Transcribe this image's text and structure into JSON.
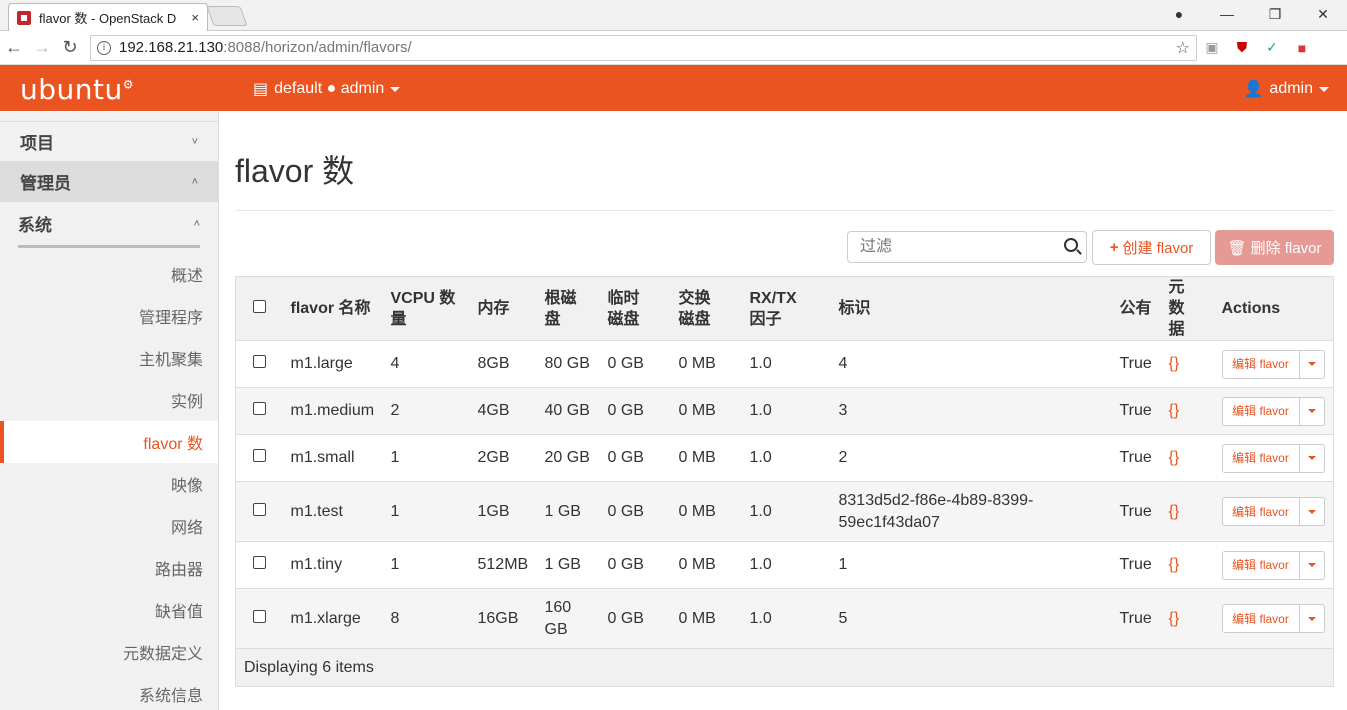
{
  "browser": {
    "tab_title": "flavor 数 - OpenStack D",
    "tab_close": "×",
    "url_host": "192.168.21.130",
    "url_path": ":8088/horizon/admin/flavors/",
    "win_min": "—",
    "win_max": "❐",
    "win_close": "✕"
  },
  "header": {
    "logo": "ubuntu",
    "project": "default ● admin",
    "user": "admin"
  },
  "sidebar": {
    "sections": [
      {
        "label": "项目",
        "chev": "˅"
      },
      {
        "label": "管理员",
        "chev": "˄"
      },
      {
        "label": "系统",
        "chev": "˄"
      }
    ],
    "items": [
      {
        "label": "概述"
      },
      {
        "label": "管理程序"
      },
      {
        "label": "主机聚集"
      },
      {
        "label": "实例"
      },
      {
        "label": "flavor 数"
      },
      {
        "label": "映像"
      },
      {
        "label": "网络"
      },
      {
        "label": "路由器"
      },
      {
        "label": "缺省值"
      },
      {
        "label": "元数据定义"
      },
      {
        "label": "系统信息"
      }
    ]
  },
  "main": {
    "title": "flavor 数",
    "filter_placeholder": "过滤",
    "create_label": "创建 flavor",
    "delete_label": "删除 flavor"
  },
  "table": {
    "headers": [
      "flavor 名称",
      "VCPU 数量",
      "内存",
      "根磁盘",
      "临时磁盘",
      "交换磁盘",
      "RX/TX 因子",
      "标识",
      "公有",
      "元数据",
      "Actions"
    ],
    "edit_label": "编辑 flavor",
    "rows": [
      {
        "name": "m1.large",
        "vcpu": "4",
        "ram": "8GB",
        "root": "80 GB",
        "eph": "0 GB",
        "swap": "0 MB",
        "rxtx": "1.0",
        "id": "4",
        "public": "True",
        "meta": "{}"
      },
      {
        "name": "m1.medium",
        "vcpu": "2",
        "ram": "4GB",
        "root": "40 GB",
        "eph": "0 GB",
        "swap": "0 MB",
        "rxtx": "1.0",
        "id": "3",
        "public": "True",
        "meta": "{}"
      },
      {
        "name": "m1.small",
        "vcpu": "1",
        "ram": "2GB",
        "root": "20 GB",
        "eph": "0 GB",
        "swap": "0 MB",
        "rxtx": "1.0",
        "id": "2",
        "public": "True",
        "meta": "{}"
      },
      {
        "name": "m1.test",
        "vcpu": "1",
        "ram": "1GB",
        "root": "1 GB",
        "eph": "0 GB",
        "swap": "0 MB",
        "rxtx": "1.0",
        "id": "8313d5d2-f86e-4b89-8399-59ec1f43da07",
        "public": "True",
        "meta": "{}"
      },
      {
        "name": "m1.tiny",
        "vcpu": "1",
        "ram": "512MB",
        "root": "1 GB",
        "eph": "0 GB",
        "swap": "0 MB",
        "rxtx": "1.0",
        "id": "1",
        "public": "True",
        "meta": "{}"
      },
      {
        "name": "m1.xlarge",
        "vcpu": "8",
        "ram": "16GB",
        "root": "160 GB",
        "eph": "0 GB",
        "swap": "0 MB",
        "rxtx": "1.0",
        "id": "5",
        "public": "True",
        "meta": "{}"
      }
    ],
    "footer": "Displaying 6 items"
  },
  "colors": {
    "brand": "#e95420",
    "delete": "#e69a96"
  }
}
